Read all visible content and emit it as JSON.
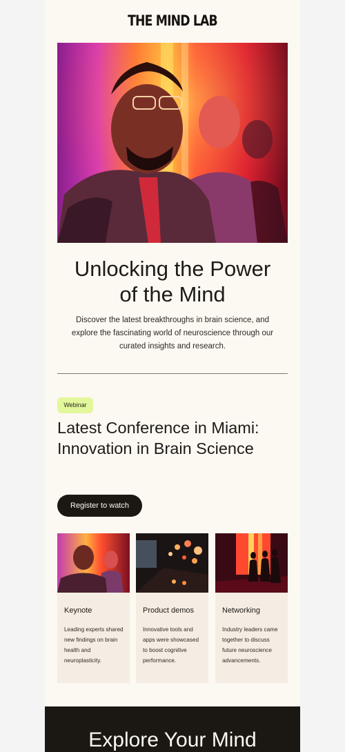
{
  "brand": {
    "logo": "THE MIND LAB"
  },
  "hero": {
    "title_line1": "Unlocking the Power",
    "title_line2": "of the Mind",
    "description": "Discover the latest breakthroughs in brain science, and explore the fascinating world of neuroscience through our curated insights and research."
  },
  "conference": {
    "badge": "Webinar",
    "title_line1": "Latest Conference in Miami:",
    "title_line2": "Innovation in Brain Science",
    "cta_label": "Register to watch"
  },
  "cards": [
    {
      "title": "Keynote",
      "description": "Leading experts shared new findings on brain health and neuroplasticity."
    },
    {
      "title": "Product demos",
      "description": "Innovative tools and apps were showcased to boost cognitive performance."
    },
    {
      "title": "Networking",
      "description": "Industry leaders came together to discuss future neuroscience advancements."
    }
  ],
  "footer": {
    "title": "Explore Your Mind"
  },
  "colors": {
    "background": "#fcf8f2",
    "dark": "#1b1814",
    "badge": "#e3f79b",
    "card": "#f5ede3"
  }
}
